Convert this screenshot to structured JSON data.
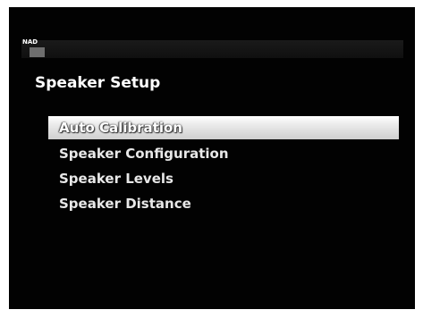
{
  "brand": {
    "name": "NAD"
  },
  "screen": {
    "title": "Speaker Setup"
  },
  "menu": {
    "items": [
      {
        "label": "Auto Calibration",
        "selected": true
      },
      {
        "label": "Speaker Configuration",
        "selected": false
      },
      {
        "label": "Speaker Levels",
        "selected": false
      },
      {
        "label": "Speaker Distance",
        "selected": false
      }
    ]
  },
  "colors": {
    "background": "#020202",
    "text": "#e8e8e8",
    "highlight": "#e9e9e9"
  }
}
